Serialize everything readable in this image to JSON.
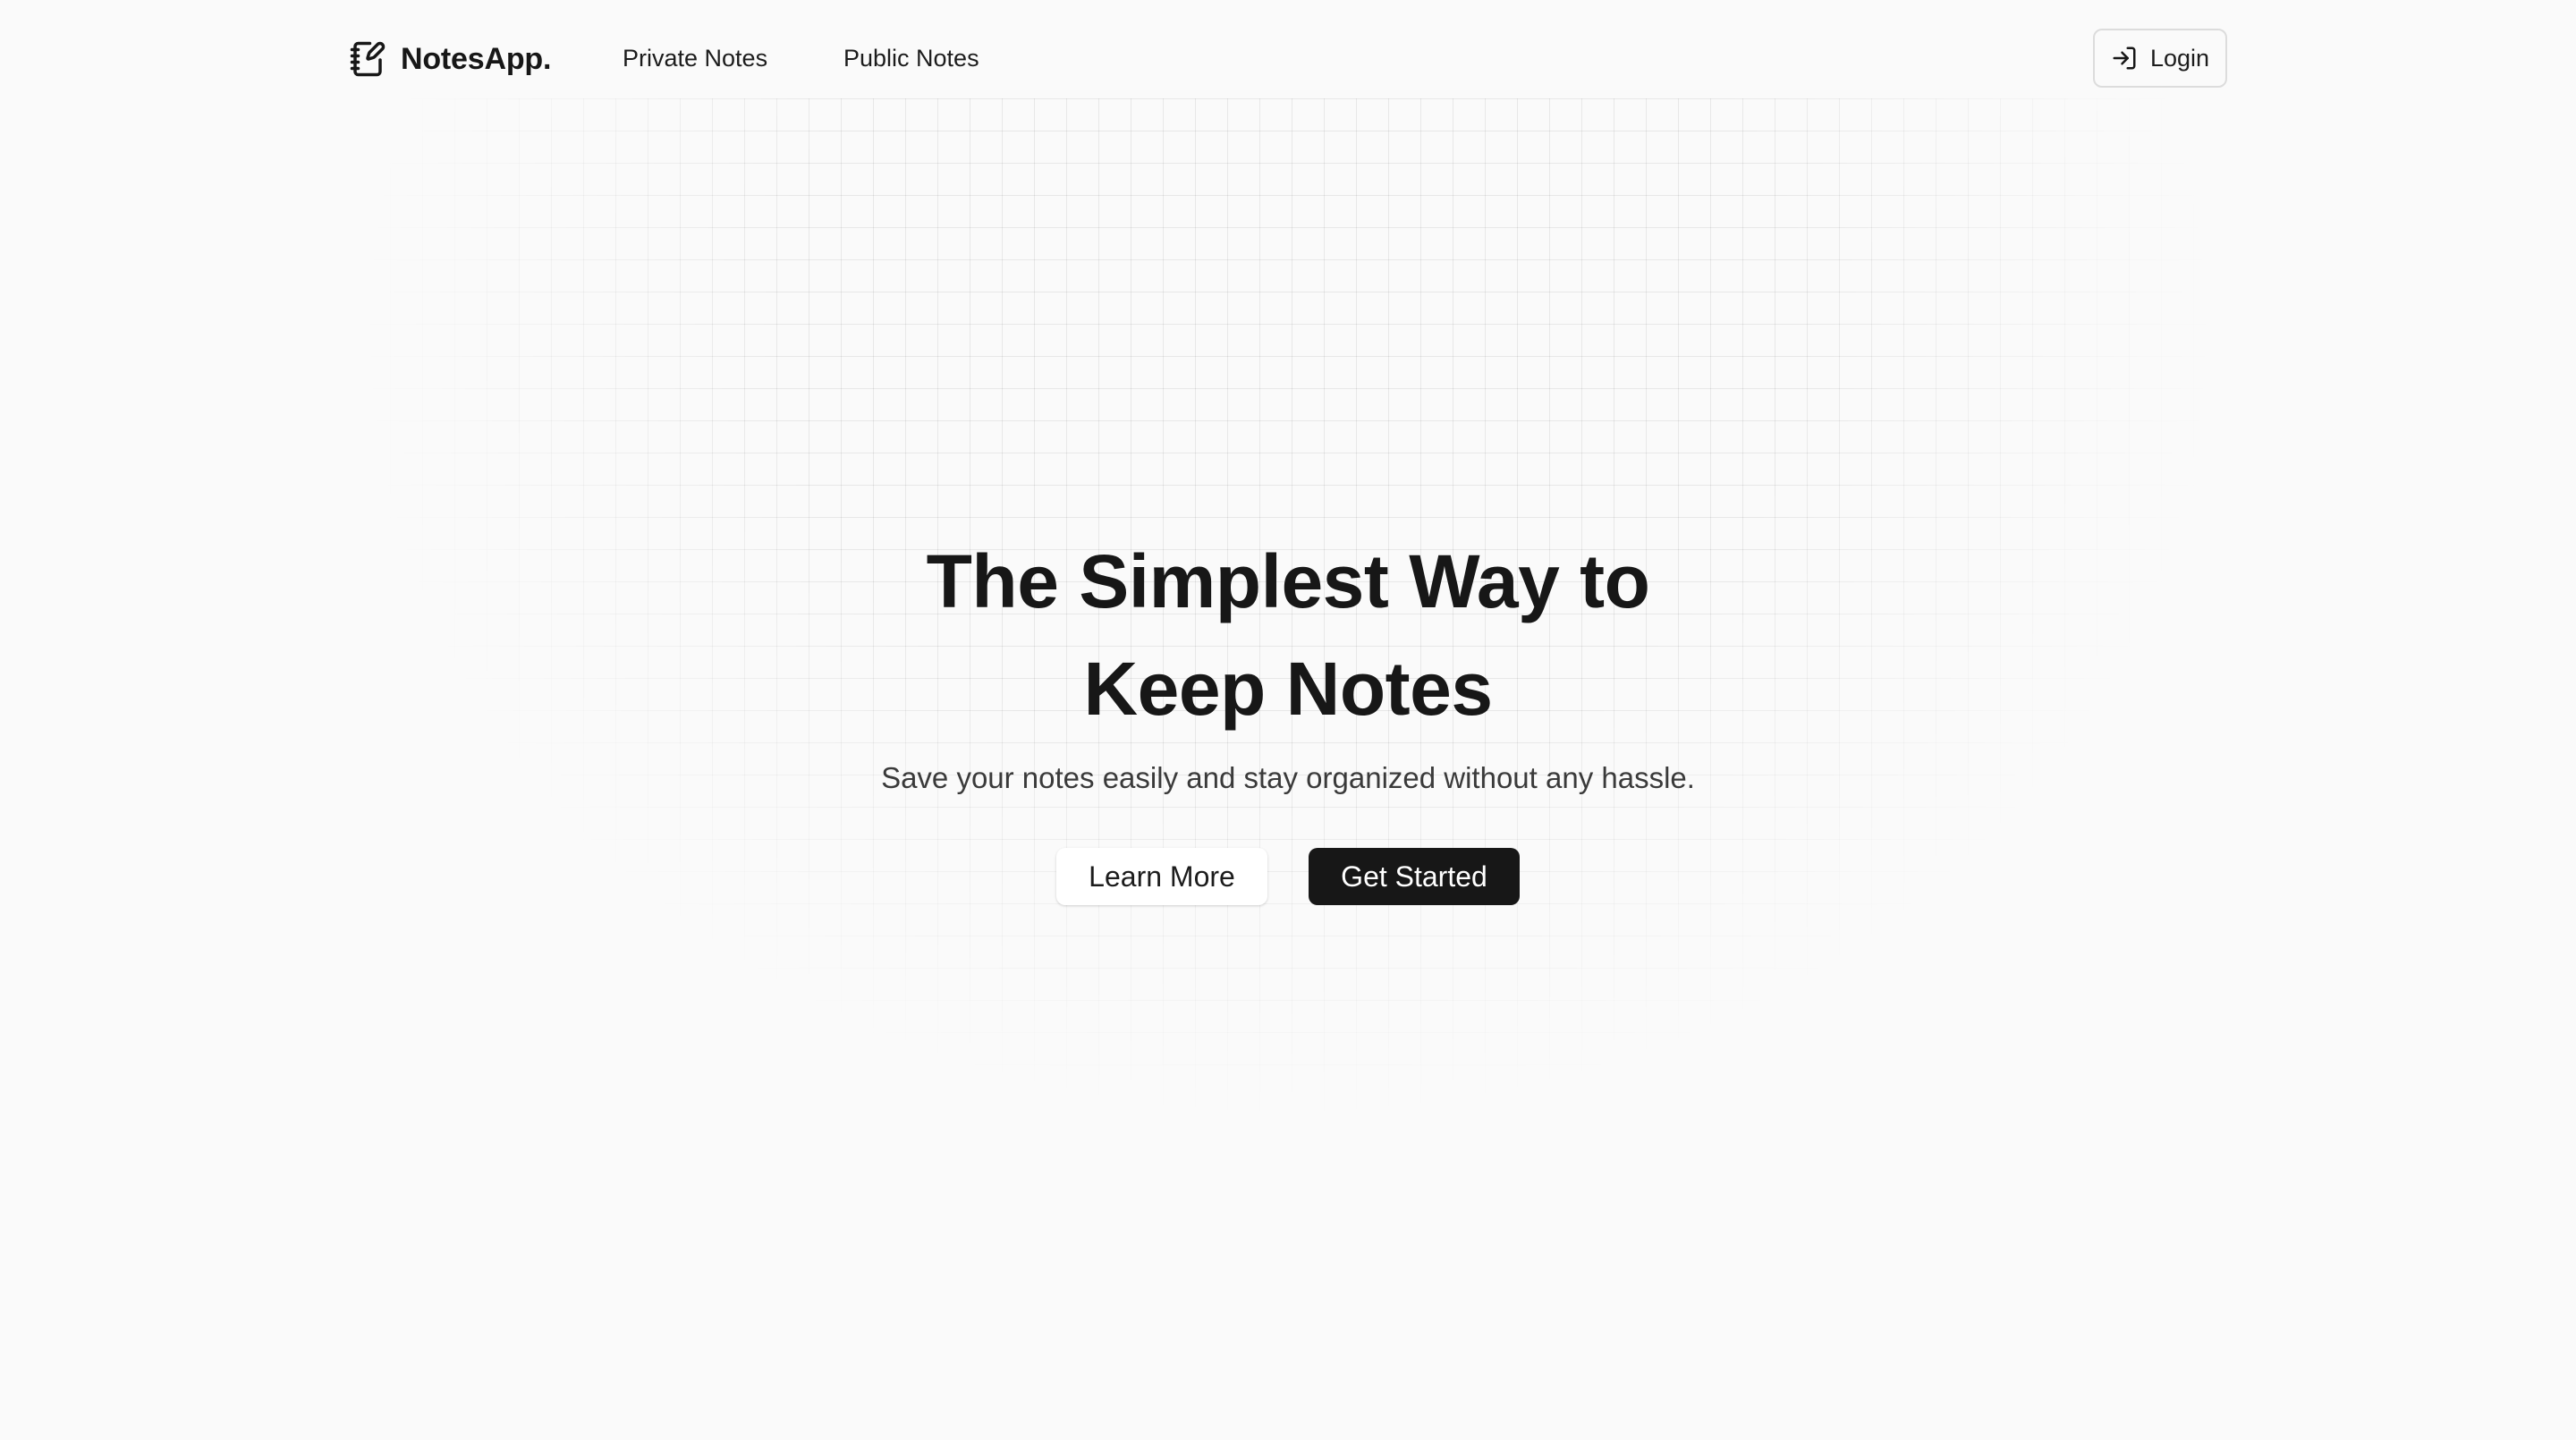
{
  "header": {
    "brand": {
      "name": "NotesApp.",
      "icon": "notebook-pen-icon"
    },
    "nav": [
      {
        "label": "Private Notes"
      },
      {
        "label": "Public Notes"
      }
    ],
    "login": {
      "label": "Login",
      "icon": "log-in-icon"
    }
  },
  "hero": {
    "title_line1": "The Simplest Way to",
    "title_line2": "Keep Notes",
    "subtitle": "Save your notes easily and stay organized without any hassle.",
    "secondary_button": "Learn More",
    "primary_button": "Get Started"
  },
  "colors": {
    "background": "#fafafa",
    "text": "#171717",
    "primary_button_bg": "#171717",
    "primary_button_text": "#ffffff",
    "border": "#dcdcdc",
    "grid_line": "rgba(0,0,0,0.07)"
  }
}
